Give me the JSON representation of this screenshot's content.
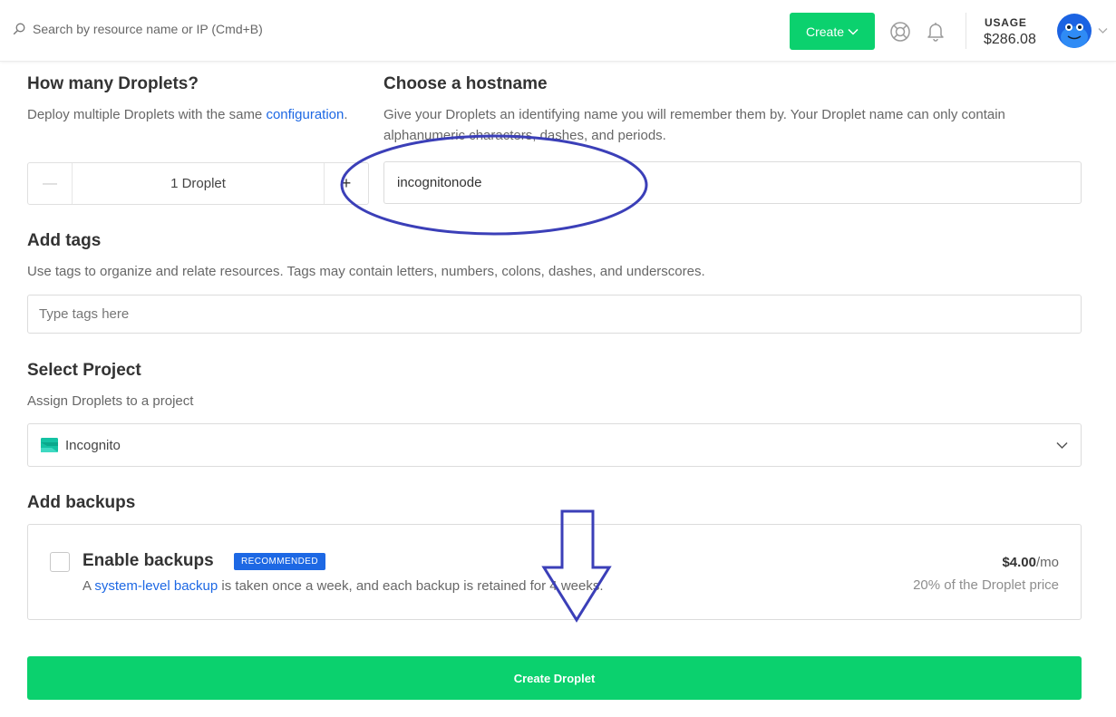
{
  "header": {
    "search_placeholder": "Search by resource name or IP (Cmd+B)",
    "create_label": "Create",
    "usage_label": "USAGE",
    "usage_value": "$286.08"
  },
  "droplets": {
    "title": "How many Droplets?",
    "desc_prefix": "Deploy multiple Droplets with the same ",
    "desc_link": "configuration",
    "desc_suffix": ".",
    "minus": "—",
    "count_label": "1 Droplet",
    "plus": "+"
  },
  "hostname": {
    "title": "Choose a hostname",
    "desc": "Give your Droplets an identifying name you will remember them by. Your Droplet name can only contain alphanumeric characters, dashes, and periods.",
    "value": "incognitonode"
  },
  "tags": {
    "title": "Add tags",
    "desc": "Use tags to organize and relate resources. Tags may contain letters, numbers, colons, dashes, and underscores.",
    "placeholder": "Type tags here"
  },
  "project": {
    "title": "Select Project",
    "desc": "Assign Droplets to a project",
    "selected": "Incognito"
  },
  "backups": {
    "title": "Add backups",
    "option_title": "Enable backups",
    "badge": "RECOMMENDED",
    "desc_prefix": "A ",
    "desc_link": "system-level backup",
    "desc_suffix": " is taken once a week, and each backup is retained for 4 weeks.",
    "price": "$4.00",
    "price_unit": "/mo",
    "price_note": "20% of the Droplet price"
  },
  "submit": {
    "label": "Create Droplet"
  },
  "colors": {
    "accent_green": "#0bd16e",
    "link_blue": "#1d68e4",
    "annotation": "#3b3fb8"
  },
  "icons": [
    "search-icon",
    "chevron-down-icon",
    "help-lifebuoy-icon",
    "bell-icon",
    "avatar-icon",
    "project-icon"
  ]
}
